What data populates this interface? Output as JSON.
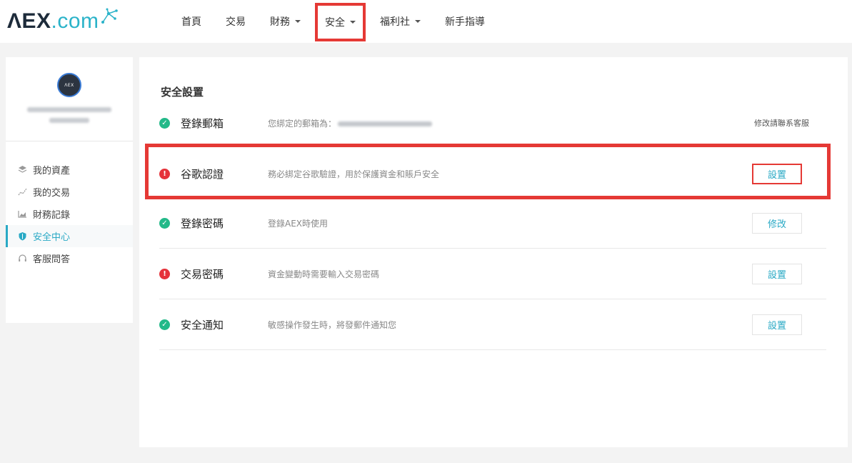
{
  "brand": {
    "logo_main": "ΛEX",
    "logo_sub": ".com"
  },
  "nav": {
    "items": [
      {
        "label": "首頁",
        "dropdown": false
      },
      {
        "label": "交易",
        "dropdown": false
      },
      {
        "label": "財務",
        "dropdown": true
      },
      {
        "label": "安全",
        "dropdown": true
      },
      {
        "label": "福利社",
        "dropdown": true
      },
      {
        "label": "新手指導",
        "dropdown": false
      }
    ]
  },
  "sidebar": {
    "avatar_text": "ΛEX",
    "menu": [
      {
        "label": "我的資產",
        "icon": "layers-icon"
      },
      {
        "label": "我的交易",
        "icon": "trend-icon"
      },
      {
        "label": "財務記錄",
        "icon": "chart-icon"
      },
      {
        "label": "安全中心",
        "icon": "shield-icon",
        "active": true
      },
      {
        "label": "客服問答",
        "icon": "headset-icon"
      }
    ]
  },
  "security": {
    "title": "安全設置",
    "rows": [
      {
        "name": "登錄郵箱",
        "status": "ok",
        "desc": "您綁定的郵箱為：",
        "action": "修改請聯系客服",
        "action_type": "note"
      },
      {
        "name": "谷歌認證",
        "status": "warn",
        "desc": "務必綁定谷歌驗證，用於保護資金和賬戶安全",
        "action": "設置",
        "action_type": "button-highlight"
      },
      {
        "name": "登錄密碼",
        "status": "ok",
        "desc": "登錄AEX時使用",
        "action": "修改",
        "action_type": "button"
      },
      {
        "name": "交易密碼",
        "status": "warn",
        "desc": "資金變動時需要輸入交易密碼",
        "action": "設置",
        "action_type": "button"
      },
      {
        "name": "安全通知",
        "status": "ok",
        "desc": "敏感操作發生時，將發郵件通知您",
        "action": "設置",
        "action_type": "button"
      }
    ]
  },
  "colors": {
    "accent": "#29a9c5",
    "ok": "#23b989",
    "warn": "#e5323a",
    "highlight": "#e53935"
  }
}
